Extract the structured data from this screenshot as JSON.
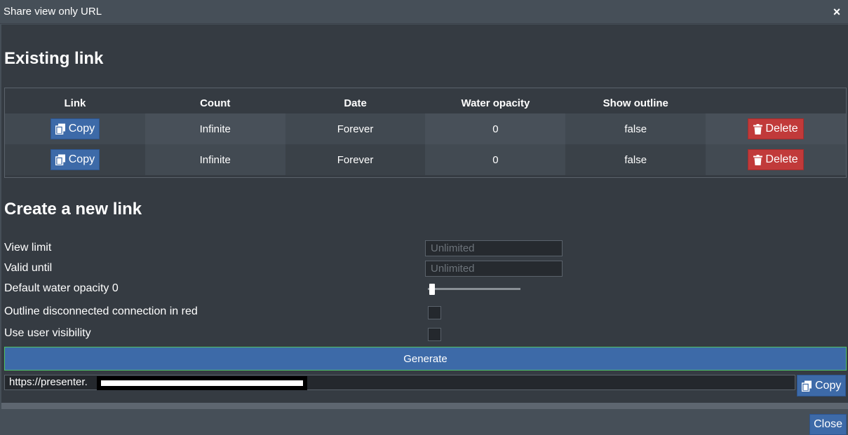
{
  "dialog": {
    "title": "Share view only URL",
    "close_icon": "×",
    "close_label": "Close"
  },
  "existing": {
    "heading": "Existing link",
    "columns": [
      "Link",
      "Count",
      "Date",
      "Water opacity",
      "Show outline",
      ""
    ],
    "rows": [
      {
        "copy_label": "Copy",
        "count": "Infinite",
        "date": "Forever",
        "water_opacity": "0",
        "show_outline": "false",
        "delete_label": "Delete"
      },
      {
        "copy_label": "Copy",
        "count": "Infinite",
        "date": "Forever",
        "water_opacity": "0",
        "show_outline": "false",
        "delete_label": "Delete"
      }
    ]
  },
  "create": {
    "heading": "Create a new link",
    "view_limit": {
      "label": "View limit",
      "placeholder": "Unlimited",
      "value": ""
    },
    "valid_until": {
      "label": "Valid until",
      "placeholder": "Unlimited",
      "value": ""
    },
    "water_opacity": {
      "label": "Default water opacity 0",
      "value": 0
    },
    "outline": {
      "label": "Outline disconnected connection in red",
      "checked": false
    },
    "user_visibility": {
      "label": "Use user visibility",
      "checked": false
    },
    "generate_label": "Generate",
    "url_value": "https://presenter.",
    "copy_label": "Copy"
  },
  "icons": {
    "copy": "copy-icon",
    "delete": "trash-icon",
    "close": "close-icon"
  },
  "colors": {
    "accent": "#3d6aa8",
    "danger": "#c13a3a",
    "background": "#353b42",
    "chrome": "#464f58"
  }
}
